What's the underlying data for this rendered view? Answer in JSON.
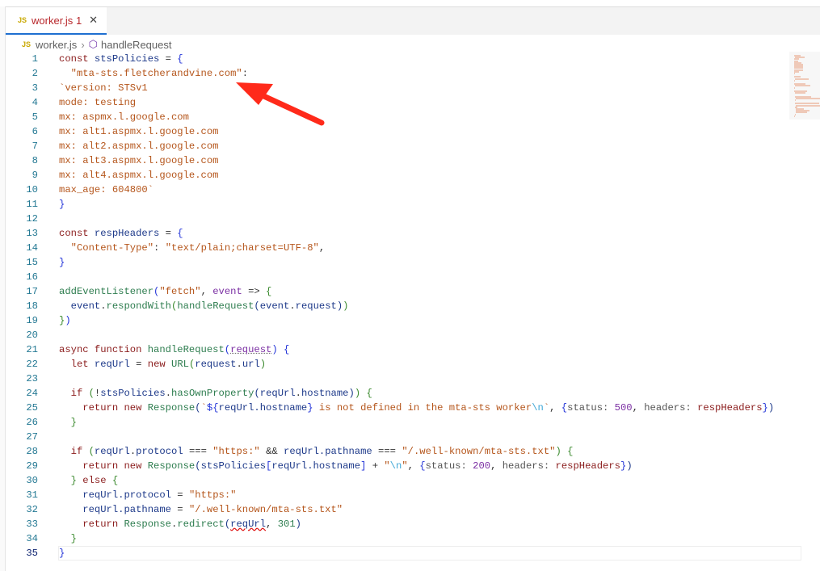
{
  "tab": {
    "icon": "js-file-icon",
    "badge": "JS",
    "name": "worker.js",
    "problems": "1"
  },
  "breadcrumb": {
    "file": "worker.js",
    "symbol": "handleRequest"
  },
  "annotation": {
    "arrow_color": "#ff2a1a"
  },
  "current_line": 35,
  "lines": [
    [
      [
        "k",
        "const "
      ],
      [
        "v",
        "stsPolicies"
      ],
      [
        "p",
        " = "
      ],
      [
        "b1",
        "{"
      ]
    ],
    [
      [
        "p",
        "  "
      ],
      [
        "s",
        "\"mta-sts.fletcherandvine.com\""
      ],
      [
        "p",
        ":"
      ]
    ],
    [
      [
        "s",
        "`version: STSv1"
      ]
    ],
    [
      [
        "s",
        "mode: testing"
      ]
    ],
    [
      [
        "s",
        "mx: aspmx.l.google.com"
      ]
    ],
    [
      [
        "s",
        "mx: alt1.aspmx.l.google.com"
      ]
    ],
    [
      [
        "s",
        "mx: alt2.aspmx.l.google.com"
      ]
    ],
    [
      [
        "s",
        "mx: alt3.aspmx.l.google.com"
      ]
    ],
    [
      [
        "s",
        "mx: alt4.aspmx.l.google.com"
      ]
    ],
    [
      [
        "s",
        "max_age: 604800`"
      ]
    ],
    [
      [
        "b1",
        "}"
      ]
    ],
    [],
    [
      [
        "k",
        "const "
      ],
      [
        "v",
        "respHeaders"
      ],
      [
        "p",
        " = "
      ],
      [
        "b1",
        "{"
      ]
    ],
    [
      [
        "p",
        "  "
      ],
      [
        "s",
        "\"Content-Type\""
      ],
      [
        "p",
        ": "
      ],
      [
        "s",
        "\"text/plain;charset=UTF-8\""
      ],
      [
        "p",
        ","
      ]
    ],
    [
      [
        "b1",
        "}"
      ]
    ],
    [],
    [
      [
        "f",
        "addEventListener"
      ],
      [
        "b1",
        "("
      ],
      [
        "s",
        "\"fetch\""
      ],
      [
        "p",
        ", "
      ],
      [
        "n",
        "event"
      ],
      [
        "p",
        " => "
      ],
      [
        "b2",
        "{"
      ]
    ],
    [
      [
        "p",
        "  "
      ],
      [
        "v",
        "event"
      ],
      [
        "p",
        "."
      ],
      [
        "f",
        "respondWith"
      ],
      [
        "b2",
        "("
      ],
      [
        "f",
        "handleRequest"
      ],
      [
        "b3",
        "("
      ],
      [
        "v",
        "event"
      ],
      [
        "p",
        "."
      ],
      [
        "v",
        "request"
      ],
      [
        "b3",
        ")"
      ],
      [
        "b2",
        ")"
      ]
    ],
    [
      [
        "b2",
        "}"
      ],
      [
        "b1",
        ")"
      ]
    ],
    [],
    [
      [
        "k",
        "async function "
      ],
      [
        "f",
        "handleRequest"
      ],
      [
        "b1",
        "("
      ],
      [
        "pm",
        "request"
      ],
      [
        "b1",
        ")"
      ],
      [
        "p",
        " "
      ],
      [
        "b1",
        "{"
      ]
    ],
    [
      [
        "p",
        "  "
      ],
      [
        "k",
        "let "
      ],
      [
        "v",
        "reqUrl"
      ],
      [
        "p",
        " = "
      ],
      [
        "k",
        "new "
      ],
      [
        "f",
        "URL"
      ],
      [
        "b2",
        "("
      ],
      [
        "v",
        "request"
      ],
      [
        "p",
        "."
      ],
      [
        "v",
        "url"
      ],
      [
        "b2",
        ")"
      ]
    ],
    [],
    [
      [
        "p",
        "  "
      ],
      [
        "k",
        "if "
      ],
      [
        "b2",
        "("
      ],
      [
        "p",
        "!"
      ],
      [
        "v",
        "stsPolicies"
      ],
      [
        "p",
        "."
      ],
      [
        "f",
        "hasOwnProperty"
      ],
      [
        "b3",
        "("
      ],
      [
        "v",
        "reqUrl"
      ],
      [
        "p",
        "."
      ],
      [
        "v",
        "hostname"
      ],
      [
        "b3",
        ")"
      ],
      [
        "b2",
        ")"
      ],
      [
        "p",
        " "
      ],
      [
        "b2",
        "{"
      ]
    ],
    [
      [
        "p",
        "    "
      ],
      [
        "k",
        "return new "
      ],
      [
        "f",
        "Response"
      ],
      [
        "b3",
        "("
      ],
      [
        "s",
        "`"
      ],
      [
        "b1",
        "${"
      ],
      [
        "v",
        "reqUrl.hostname"
      ],
      [
        "b1",
        "}"
      ],
      [
        "s",
        " is not defined in the mta-sts worker"
      ],
      [
        "e",
        "\\n"
      ],
      [
        "s",
        "`"
      ],
      [
        "p",
        ", "
      ],
      [
        "b1",
        "{"
      ],
      [
        "g",
        "status: "
      ],
      [
        "n",
        "500"
      ],
      [
        "p",
        ", "
      ],
      [
        "g",
        "headers: "
      ],
      [
        "k",
        "respHeaders"
      ],
      [
        "b1",
        "}"
      ],
      [
        "b3",
        ")"
      ]
    ],
    [
      [
        "p",
        "  "
      ],
      [
        "b2",
        "}"
      ]
    ],
    [],
    [
      [
        "p",
        "  "
      ],
      [
        "k",
        "if "
      ],
      [
        "b2",
        "("
      ],
      [
        "v",
        "reqUrl"
      ],
      [
        "p",
        "."
      ],
      [
        "v",
        "protocol"
      ],
      [
        "p",
        " === "
      ],
      [
        "s",
        "\"https:\""
      ],
      [
        "p",
        " && "
      ],
      [
        "v",
        "reqUrl.pathname"
      ],
      [
        "p",
        " === "
      ],
      [
        "s",
        "\"/.well-known/mta-sts.txt\""
      ],
      [
        "b2",
        ")"
      ],
      [
        "p",
        " "
      ],
      [
        "b2",
        "{"
      ]
    ],
    [
      [
        "p",
        "    "
      ],
      [
        "k",
        "return new "
      ],
      [
        "f",
        "Response"
      ],
      [
        "b3",
        "("
      ],
      [
        "v",
        "stsPolicies"
      ],
      [
        "b1",
        "["
      ],
      [
        "v",
        "reqUrl.hostname"
      ],
      [
        "b1",
        "]"
      ],
      [
        "p",
        " + "
      ],
      [
        "s",
        "\""
      ],
      [
        "e",
        "\\n"
      ],
      [
        "s",
        "\""
      ],
      [
        "p",
        ", "
      ],
      [
        "b1",
        "{"
      ],
      [
        "g",
        "status: "
      ],
      [
        "n",
        "200"
      ],
      [
        "p",
        ", "
      ],
      [
        "g",
        "headers: "
      ],
      [
        "k",
        "respHeaders"
      ],
      [
        "b1",
        "}"
      ],
      [
        "b3",
        ")"
      ]
    ],
    [
      [
        "p",
        "  "
      ],
      [
        "b2",
        "}"
      ],
      [
        "p",
        " "
      ],
      [
        "k",
        "else "
      ],
      [
        "b2",
        "{"
      ]
    ],
    [
      [
        "p",
        "    "
      ],
      [
        "v",
        "reqUrl.protocol"
      ],
      [
        "p",
        " = "
      ],
      [
        "s",
        "\"https:\""
      ]
    ],
    [
      [
        "p",
        "    "
      ],
      [
        "v",
        "reqUrl.pathname"
      ],
      [
        "p",
        " = "
      ],
      [
        "s",
        "\"/.well-known/mta-sts.txt\""
      ]
    ],
    [
      [
        "p",
        "    "
      ],
      [
        "k",
        "return "
      ],
      [
        "f",
        "Response"
      ],
      [
        "p",
        "."
      ],
      [
        "f",
        "redirect"
      ],
      [
        "b3",
        "("
      ],
      [
        "sq",
        "reqUrl"
      ],
      [
        "p",
        ", "
      ],
      [
        "f",
        "301"
      ],
      [
        "b3",
        ")"
      ]
    ],
    [
      [
        "p",
        "  "
      ],
      [
        "b2",
        "}"
      ]
    ],
    [
      [
        "b1",
        "}"
      ]
    ]
  ]
}
